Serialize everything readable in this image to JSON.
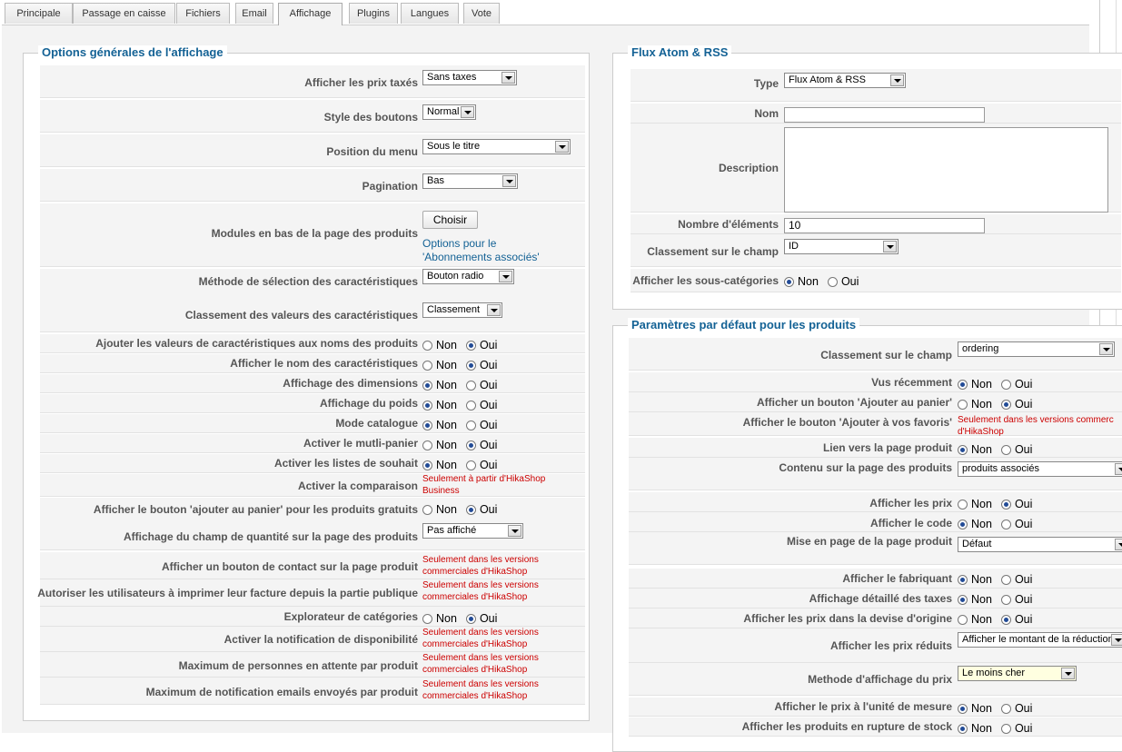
{
  "tabs": [
    "Principale",
    "Passage en caisse",
    "Fichiers",
    "Email",
    "Affichage",
    "Plugins",
    "Langues",
    "Vote"
  ],
  "active_tab": "Affichage",
  "choices": {
    "no": "Non",
    "yes": "Oui"
  },
  "left": {
    "legend": "Options générales de l'affichage",
    "rows": [
      {
        "label": "Afficher les prix taxés",
        "type": "select",
        "value": "Sans taxes"
      },
      {
        "label": "Style des boutons",
        "type": "select",
        "value": "Normal"
      },
      {
        "label": "Position du menu",
        "type": "select",
        "value": "Sous le titre"
      },
      {
        "label": "Pagination",
        "type": "select",
        "value": "Bas"
      },
      {
        "label": "Modules en bas de la page des produits",
        "type": "button",
        "button": "Choisir",
        "link": [
          "Options pour le",
          "'Abonnements associés'"
        ]
      },
      {
        "label": "Méthode de sélection des caractéristiques",
        "type": "select",
        "value": "Bouton radio"
      },
      {
        "label": "Classement des valeurs des caractéristiques",
        "type": "select",
        "value": "Classement"
      },
      {
        "label": "Ajouter les valeurs de caractéristiques aux noms des produits",
        "type": "radio",
        "value": "Oui"
      },
      {
        "label": "Afficher le nom des caractéristiques",
        "type": "radio",
        "value": "Oui"
      },
      {
        "label": "Affichage des dimensions",
        "type": "radio",
        "value": "Non"
      },
      {
        "label": "Affichage du poids",
        "type": "radio",
        "value": "Non"
      },
      {
        "label": "Mode catalogue",
        "type": "radio",
        "value": "Non"
      },
      {
        "label": "Activer le mutli-panier",
        "type": "radio",
        "value": "Oui"
      },
      {
        "label": "Activer les listes de souhait",
        "type": "radio",
        "value": "Non"
      },
      {
        "label": "Activer la comparaison",
        "type": "note",
        "note": [
          "Seulement à partir d'HikaShop",
          "Business"
        ]
      },
      {
        "label": "Afficher le bouton 'ajouter au panier' pour les produits gratuits",
        "type": "radio",
        "value": "Oui"
      },
      {
        "label": "Affichage du champ de quantité sur la page des produits",
        "type": "select",
        "value": "Pas affiché"
      },
      {
        "label": "Afficher un bouton de contact sur la page produit",
        "type": "note",
        "note": [
          "Seulement dans les versions",
          "commerciales d'HikaShop"
        ]
      },
      {
        "label": "Autoriser les utilisateurs à imprimer leur facture depuis la partie publique",
        "type": "note",
        "note": [
          "Seulement dans les versions",
          "commerciales d'HikaShop"
        ]
      },
      {
        "label": "Explorateur de catégories",
        "type": "radio",
        "value": "Oui"
      },
      {
        "label": "Activer la notification de disponibilité",
        "type": "note",
        "note": [
          "Seulement dans les versions",
          "commerciales d'HikaShop"
        ]
      },
      {
        "label": "Maximum de personnes en attente par produit",
        "type": "note",
        "note": [
          "Seulement dans les versions",
          "commerciales d'HikaShop"
        ]
      },
      {
        "label": "Maximum de notification emails envoyés par produit",
        "type": "note",
        "note": [
          "Seulement dans les versions",
          "commerciales d'HikaShop"
        ]
      }
    ]
  },
  "feed": {
    "legend": "Flux Atom & RSS",
    "rows": [
      {
        "label": "Type",
        "type": "select",
        "value": "Flux Atom & RSS"
      },
      {
        "label": "Nom",
        "type": "text",
        "value": ""
      },
      {
        "label": "Description",
        "type": "textarea",
        "value": ""
      },
      {
        "label": "Nombre d'éléments",
        "type": "text",
        "value": "10"
      },
      {
        "label": "Classement sur le champ",
        "type": "select",
        "value": "ID"
      },
      {
        "label": "Afficher les sous-catégories",
        "type": "radio",
        "value": "Non"
      }
    ]
  },
  "defaults": {
    "legend": "Paramètres par défaut pour les produits",
    "rows": [
      {
        "label": "Classement sur le champ",
        "type": "select",
        "value": "ordering"
      },
      {
        "label": "Vus récemment",
        "type": "radio",
        "value": "Non"
      },
      {
        "label": "Afficher un bouton 'Ajouter au panier'",
        "type": "radio",
        "value": "Oui"
      },
      {
        "label": "Afficher le bouton 'Ajouter à vos favoris'",
        "type": "note",
        "note": [
          "Seulement dans les versions commerc",
          "d'HikaShop"
        ]
      },
      {
        "label": "Lien vers la page produit",
        "type": "radio",
        "value": "Non"
      },
      {
        "label": "Contenu sur la page des produits",
        "type": "select",
        "value": "produits associés"
      },
      {
        "label": "Afficher les prix",
        "type": "radio",
        "value": "Oui"
      },
      {
        "label": "Afficher le code",
        "type": "radio",
        "value": "Non"
      },
      {
        "label": "Mise en page de la page produit",
        "type": "select",
        "value": "Défaut"
      },
      {
        "label": "Afficher le fabriquant",
        "type": "radio",
        "value": "Non"
      },
      {
        "label": "Affichage détaillé des taxes",
        "type": "radio",
        "value": "Non"
      },
      {
        "label": "Afficher les prix dans la devise d'origine",
        "type": "radio",
        "value": "Oui"
      },
      {
        "label": "Afficher les prix réduits",
        "type": "select",
        "value": "Afficher le montant de la réduction"
      },
      {
        "label": "Methode d'affichage du prix",
        "type": "select",
        "value": "Le moins cher"
      },
      {
        "label": "Afficher le prix à l'unité de mesure",
        "type": "radio",
        "value": "Non"
      },
      {
        "label": "Afficher les produits en rupture de stock",
        "type": "radio",
        "value": "Non"
      }
    ]
  }
}
